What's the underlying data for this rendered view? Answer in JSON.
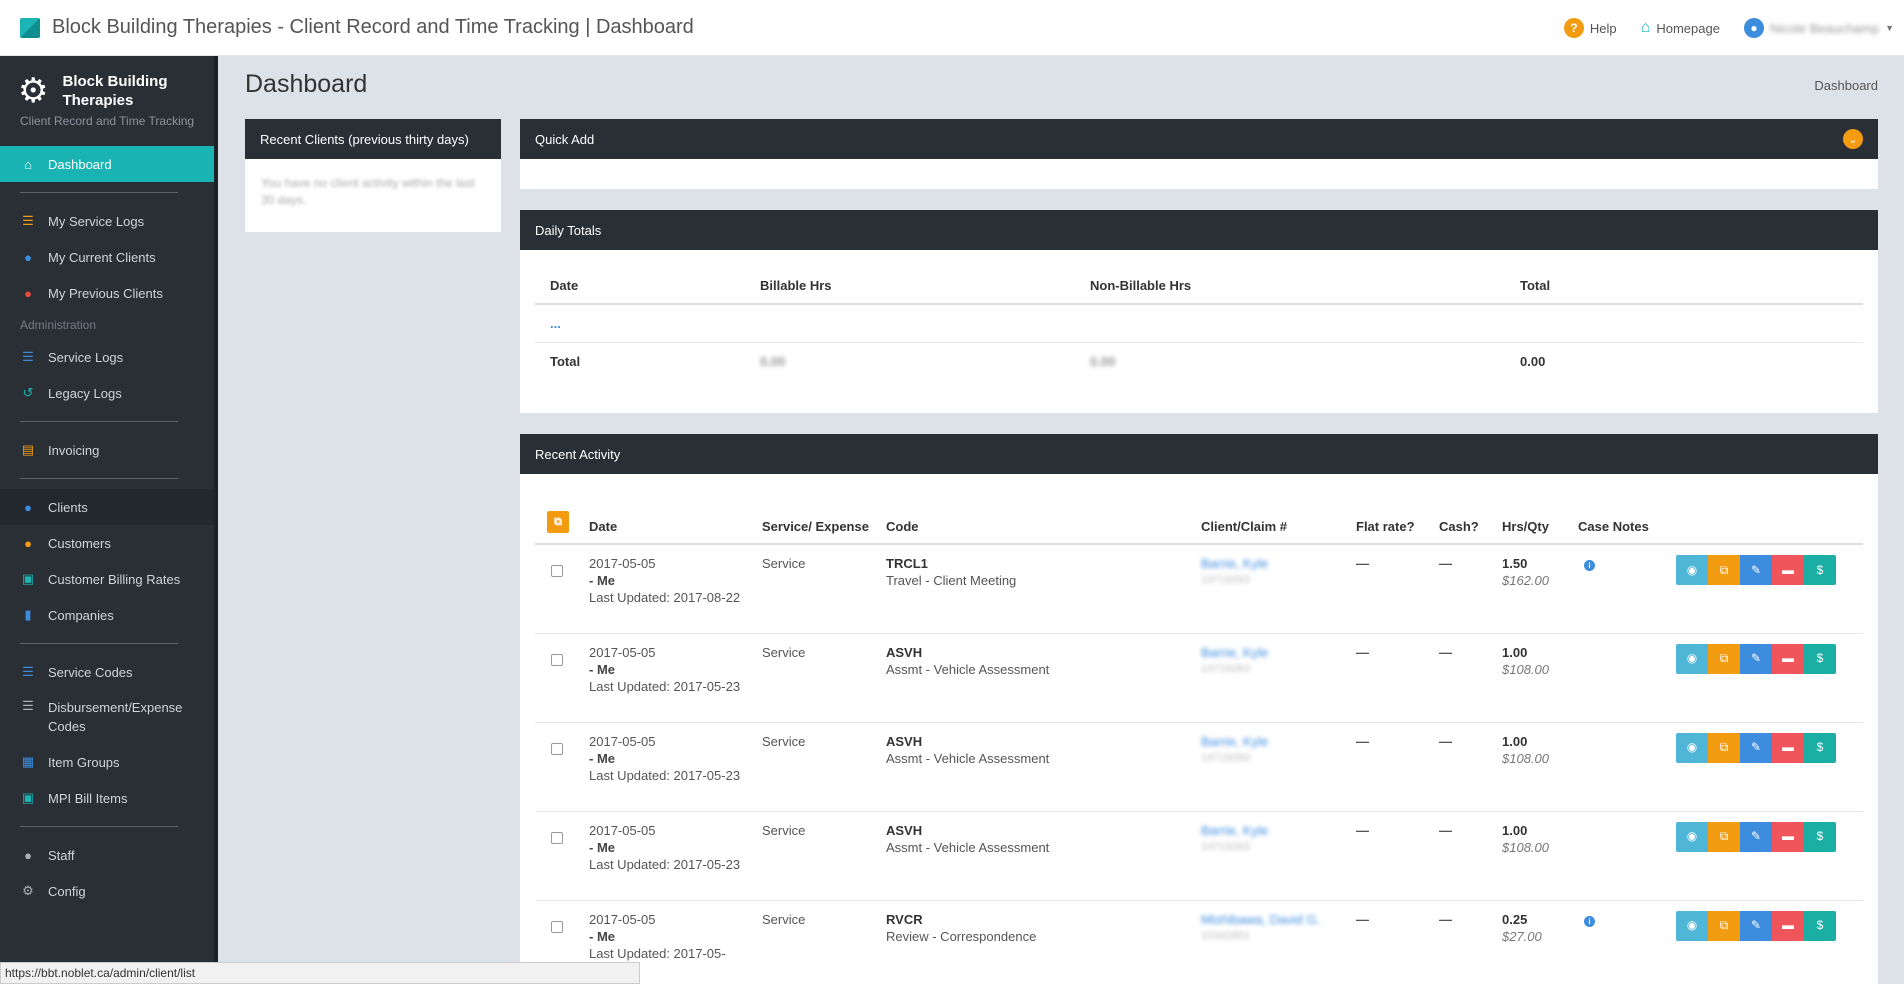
{
  "app": {
    "title": "Block Building Therapies - Client Record and Time Tracking | Dashboard"
  },
  "topnav": {
    "help": "Help",
    "homepage": "Homepage",
    "user": "Nicole Beauchamp"
  },
  "sidebar": {
    "brand_name": "Block Building Therapies",
    "brand_sub": "Client Record and Time Tracking",
    "section_admin": "Administration",
    "items": {
      "dashboard": "Dashboard",
      "my_service_logs": "My Service Logs",
      "my_current_clients": "My Current Clients",
      "my_previous_clients": "My Previous Clients",
      "service_logs": "Service Logs",
      "legacy_logs": "Legacy Logs",
      "invoicing": "Invoicing",
      "clients": "Clients",
      "customers": "Customers",
      "customer_billing_rates": "Customer Billing Rates",
      "companies": "Companies",
      "service_codes": "Service Codes",
      "disbursement_codes": "Disbursement/Expense Codes",
      "item_groups": "Item Groups",
      "mpi_bill_items": "MPI Bill Items",
      "staff": "Staff",
      "config": "Config"
    }
  },
  "page": {
    "title": "Dashboard",
    "breadcrumb": "Dashboard"
  },
  "recent_clients": {
    "title": "Recent Clients (previous thirty days)",
    "empty": "You have no client activity within the last 30 days."
  },
  "quick_add": {
    "title": "Quick Add"
  },
  "daily_totals": {
    "title": "Daily Totals",
    "headers": [
      "Date",
      "Billable Hrs",
      "Non-Billable Hrs",
      "Total"
    ],
    "row_dots": "...",
    "total_label": "Total",
    "billable_total": "0.00",
    "nonbillable_total": "0.00",
    "grand_total": "0.00"
  },
  "recent_activity": {
    "title": "Recent Activity",
    "headers": {
      "date": "Date",
      "service": "Service/ Expense",
      "code": "Code",
      "client": "Client/Claim #",
      "flat": "Flat rate?",
      "cash": "Cash?",
      "hrs": "Hrs/Qty",
      "notes": "Case Notes"
    },
    "rows": [
      {
        "date": "2017-05-05",
        "who": "- Me",
        "updated": "Last Updated: 2017-08-22",
        "type": "Service",
        "code": "TRCL1",
        "desc": "Travel - Client Meeting",
        "client": "Barrie, Kyle",
        "claim": "14719263",
        "flat": "—",
        "cash": "—",
        "hrs": "1.50",
        "amount": "$162.00",
        "notes": true
      },
      {
        "date": "2017-05-05",
        "who": "- Me",
        "updated": "Last Updated: 2017-05-23",
        "type": "Service",
        "code": "ASVH",
        "desc": "Assmt - Vehicle Assessment",
        "client": "Barrie, Kyle",
        "claim": "14719263",
        "flat": "—",
        "cash": "—",
        "hrs": "1.00",
        "amount": "$108.00",
        "notes": false
      },
      {
        "date": "2017-05-05",
        "who": "- Me",
        "updated": "Last Updated: 2017-05-23",
        "type": "Service",
        "code": "ASVH",
        "desc": "Assmt - Vehicle Assessment",
        "client": "Barrie, Kyle",
        "claim": "14719263",
        "flat": "—",
        "cash": "—",
        "hrs": "1.00",
        "amount": "$108.00",
        "notes": false
      },
      {
        "date": "2017-05-05",
        "who": "- Me",
        "updated": "Last Updated: 2017-05-23",
        "type": "Service",
        "code": "ASVH",
        "desc": "Assmt - Vehicle Assessment",
        "client": "Barrie, Kyle",
        "claim": "14719263",
        "flat": "—",
        "cash": "—",
        "hrs": "1.00",
        "amount": "$108.00",
        "notes": false
      },
      {
        "date": "2017-05-05",
        "who": "- Me",
        "updated": "Last Updated: 2017-05-",
        "type": "Service",
        "code": "RVCR",
        "desc": "Review - Correspondence",
        "client": "Mishibawa, David G.",
        "claim": "15342851",
        "flat": "—",
        "cash": "—",
        "hrs": "0.25",
        "amount": "$27.00",
        "notes": true
      }
    ]
  },
  "statusbar": {
    "url": "https://bbt.noblet.ca/admin/client/list"
  }
}
